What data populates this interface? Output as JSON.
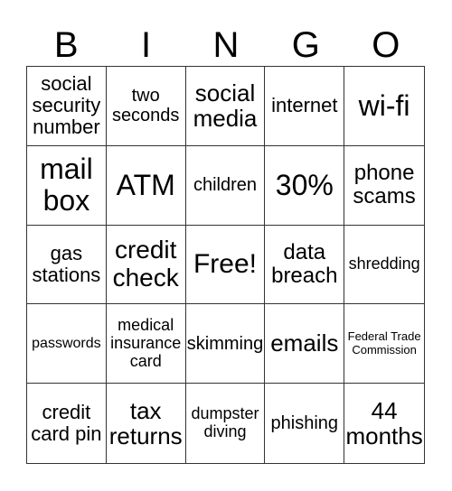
{
  "header": [
    "B",
    "I",
    "N",
    "G",
    "O"
  ],
  "cells": [
    "social security number",
    "two seconds",
    "social media",
    "internet",
    "wi-fi",
    "mail box",
    "ATM",
    "children",
    "30%",
    "phone scams",
    "gas stations",
    "credit check",
    "Free!",
    "data breach",
    "shredding",
    "passwords",
    "medical insurance card",
    "skimming",
    "emails",
    "Federal Trade Commission",
    "credit card pin",
    "tax returns",
    "dumpster diving",
    "phishing",
    "44 months"
  ]
}
